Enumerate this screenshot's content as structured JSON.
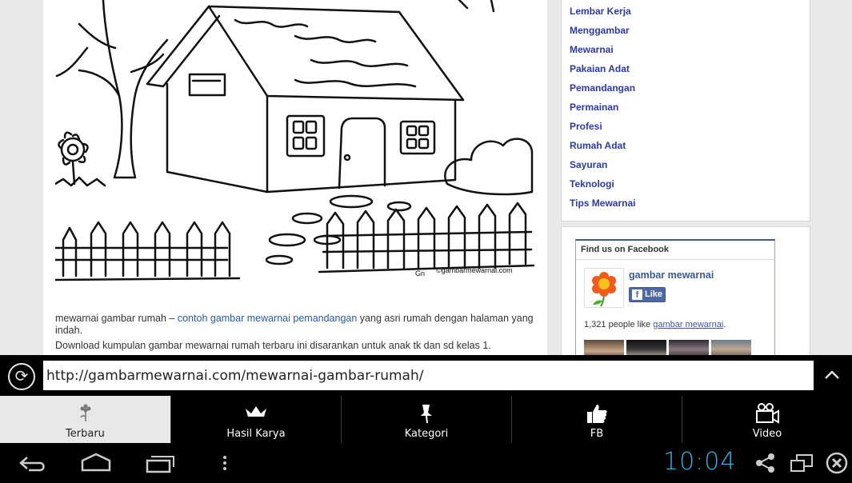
{
  "post": {
    "caption_prefix": "mewarnai gambar rumah – ",
    "caption_link": "contoh gambar mewarnai pemandangan",
    "caption_suffix": " yang asri rumah dengan halaman yang indah.",
    "description": "Download kumpulan gambar mewarnai rumah terbaru ini disarankan untuk anak tk dan sd kelas 1.",
    "image_signature": "Gn",
    "image_watermark": "©gambarmewarnai.com"
  },
  "sidebar": {
    "categories": [
      "Lembar Kerja",
      "Menggambar",
      "Mewarnai",
      "Pakaian Adat",
      "Pemandangan",
      "Permainan",
      "Profesi",
      "Rumah Adat",
      "Sayuran",
      "Teknologi",
      "Tips Mewarnai"
    ]
  },
  "facebook": {
    "header": "Find us on Facebook",
    "page_name": "gambar mewarnai",
    "like_label": "Like",
    "count_prefix": "1,321 people like ",
    "count_link": "gambar mewarnai",
    "count_suffix": "."
  },
  "urlbar": {
    "url": "http://gambarmewarnai.com/mewarnai-gambar-rumah/"
  },
  "tabs": [
    {
      "label": "Terbaru",
      "icon": "flower-icon"
    },
    {
      "label": "Hasil Karya",
      "icon": "crown-icon"
    },
    {
      "label": "Kategori",
      "icon": "pin-icon"
    },
    {
      "label": "FB",
      "icon": "thumbs-up-icon"
    },
    {
      "label": "Video",
      "icon": "video-camera-icon"
    }
  ],
  "system": {
    "clock": "10:04"
  },
  "colors": {
    "accent_blue": "#2fb1e7",
    "link_blue": "#2a58b5",
    "category_blue": "#2a3aa8",
    "facebook_blue": "#3b5998"
  }
}
